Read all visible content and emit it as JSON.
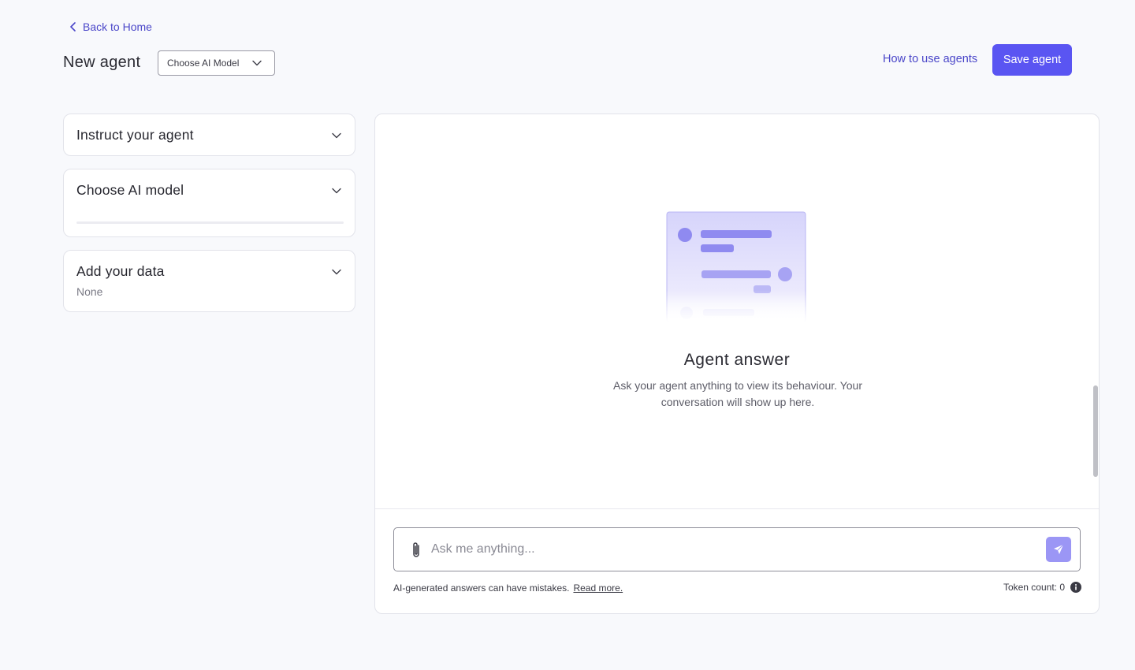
{
  "header": {
    "back_label": "Back to Home",
    "page_title": "New agent",
    "model_select_value": "Choose AI Model",
    "how_to_label": "How to use agents",
    "save_label": "Save agent"
  },
  "sidebar": {
    "sections": [
      {
        "title": "Instruct your agent"
      },
      {
        "title": "Choose AI model"
      },
      {
        "title": "Add your data",
        "subtitle": "None"
      }
    ]
  },
  "chat": {
    "empty_title": "Agent answer",
    "empty_description": "Ask your agent anything to view its behaviour. Your conversation will show up here.",
    "input_placeholder": "Ask me anything...",
    "disclaimer": "AI-generated answers can have mistakes.",
    "read_more_label": "Read more.",
    "token_label": "Token count: 0"
  },
  "colors": {
    "accent": "#5a55f2",
    "link": "#4b47c9",
    "send_button": "#9b96f5"
  },
  "icons": [
    "chevron-left-icon",
    "chevron-down-icon",
    "paperclip-icon",
    "send-icon",
    "info-icon"
  ]
}
